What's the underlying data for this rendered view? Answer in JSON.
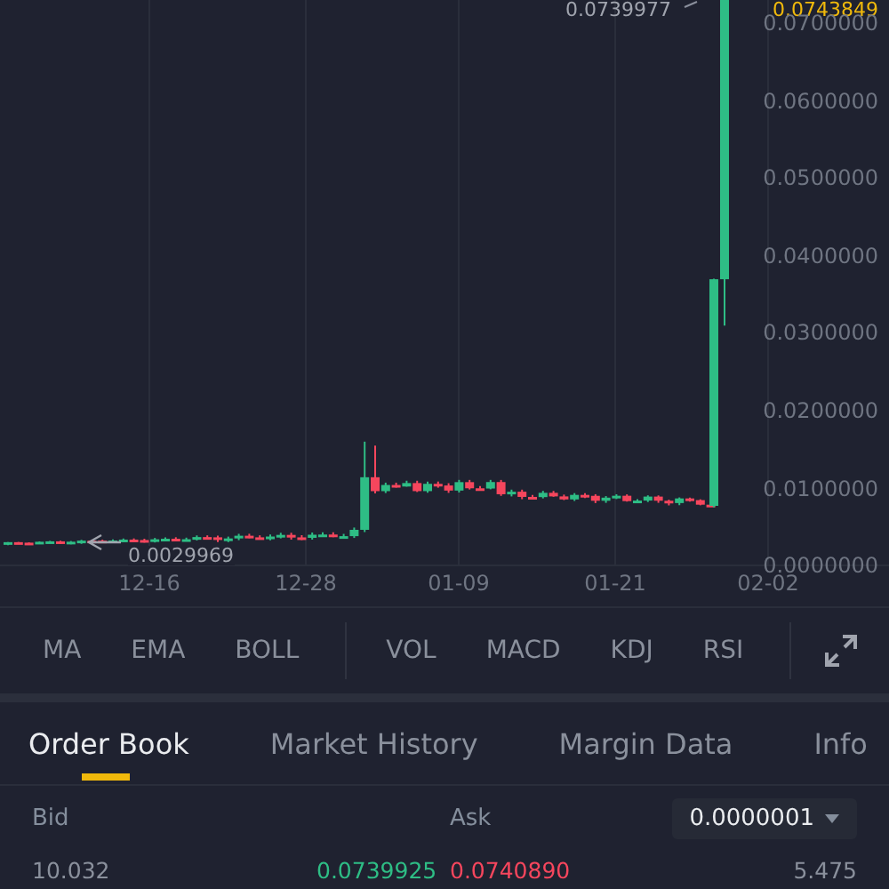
{
  "chart": {
    "high_label": "0.0739977",
    "last_price": "0.0743849",
    "low_label": "0.0029969",
    "y_axis": [
      "0.0700000",
      "0.0600000",
      "0.0500000",
      "0.0400000",
      "0.0300000",
      "0.0200000",
      "0.0100000",
      "0.0000000"
    ],
    "x_axis": [
      "12-16",
      "12-28",
      "01-09",
      "01-21",
      "02-02"
    ]
  },
  "indicators": {
    "main": [
      "MA",
      "EMA",
      "BOLL"
    ],
    "sub": [
      "VOL",
      "MACD",
      "KDJ",
      "RSI"
    ]
  },
  "tabs": [
    {
      "label": "Order Book",
      "selected": true
    },
    {
      "label": "Market History",
      "selected": false
    },
    {
      "label": "Margin Data",
      "selected": false
    },
    {
      "label": "Info",
      "selected": false
    }
  ],
  "order_book": {
    "bid_header": "Bid",
    "ask_header": "Ask",
    "precision": "0.0000001",
    "rows": [
      {
        "bid_amount": "10.032",
        "bid_price": "0.0739925",
        "ask_price": "0.0740890",
        "ask_amount": "5.475"
      }
    ]
  }
}
